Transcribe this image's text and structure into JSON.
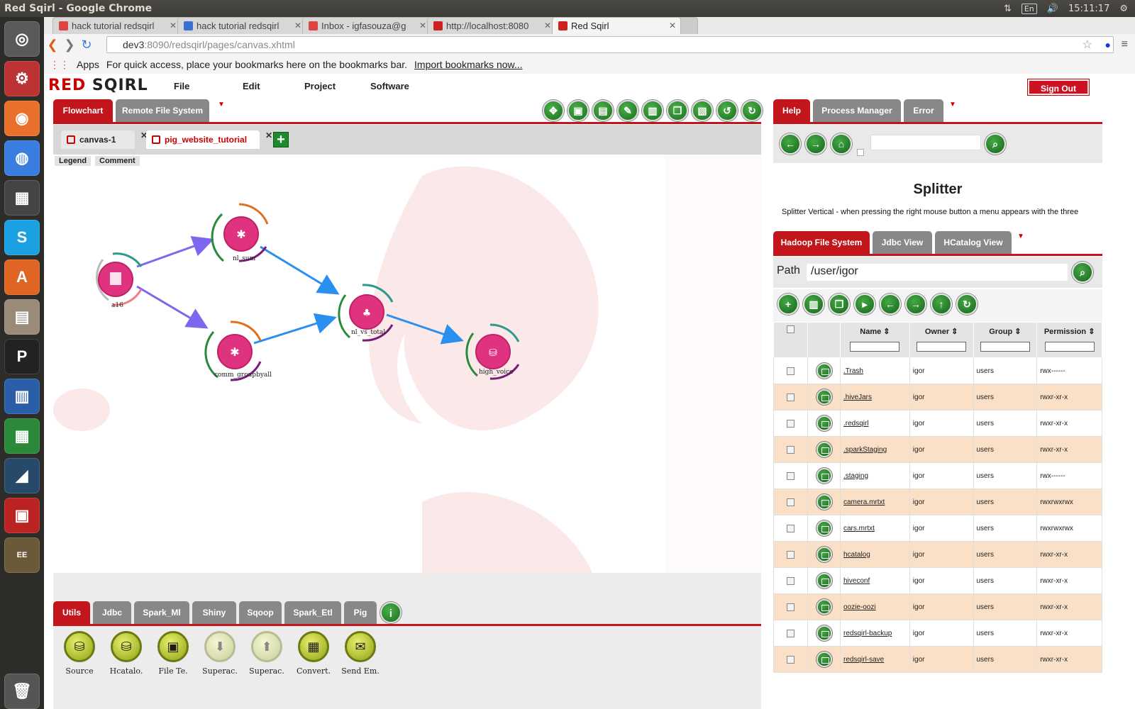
{
  "os": {
    "window_title": "Red Sqirl - Google Chrome",
    "keyboard": "En",
    "clock": "15:11:17"
  },
  "browser": {
    "tabs": [
      {
        "title": "hack tutorial redsqirl",
        "icon": "gmail-icon"
      },
      {
        "title": "hack tutorial redsqirl",
        "icon": "docs-icon"
      },
      {
        "title": "Inbox - igfasouza@g",
        "icon": "gmail-icon"
      },
      {
        "title": "http://localhost:8080",
        "icon": "redsqirl-icon"
      },
      {
        "title": "Red Sqirl",
        "icon": "redsqirl-icon"
      }
    ],
    "url_host": "dev3",
    "url_rest": ":8090/redsqirl/pages/canvas.xhtml",
    "bookmarks_apps": "Apps",
    "bookmarks_text": "For quick access, place your bookmarks here on the bookmarks bar.",
    "bookmarks_link": "Import bookmarks now..."
  },
  "app": {
    "logo_red": "RED",
    "logo_rest": " SQIRL",
    "menu": [
      "File",
      "Edit",
      "Project",
      "Software"
    ],
    "sign_out": "Sign Out"
  },
  "left": {
    "tabs": [
      "Flowchart",
      "Remote File System"
    ],
    "canvas_tabs": [
      "canvas-1",
      "pig_website_tutorial"
    ],
    "small_tabs": [
      "Legend",
      "Comment"
    ],
    "nodes": [
      {
        "label": "a16"
      },
      {
        "label": "nl_sum"
      },
      {
        "label": "comm_groupbyall"
      },
      {
        "label": "nl_vs_total"
      },
      {
        "label": "high_voice"
      }
    ],
    "palette_tabs": [
      "Utils",
      "Jdbc",
      "Spark_Ml",
      "Shiny",
      "Sqoop",
      "Spark_Etl",
      "Pig"
    ],
    "palette_items": [
      "Source",
      "Hcatalo.",
      "File Te.",
      "Superac.",
      "Superac.",
      "Convert.",
      "Send Em."
    ]
  },
  "right": {
    "tabs": [
      "Help",
      "Process Manager",
      "Error"
    ],
    "help_title": "Splitter",
    "help_text": "Splitter Vertical - when pressing the right mouse button a menu appears with the three options for Right, Middle, and Left. Clicking on the splitter option changes the position",
    "fs_tabs": [
      "Hadoop File System",
      "Jdbc View",
      "HCatalog View"
    ],
    "path_label": "Path",
    "path_value": "/user/igor",
    "columns": [
      "Name",
      "Owner",
      "Group",
      "Permission"
    ],
    "files": [
      {
        "name": ".Trash",
        "owner": "igor",
        "group": "users",
        "perm": "rwx------"
      },
      {
        "name": ".hiveJars",
        "owner": "igor",
        "group": "users",
        "perm": "rwxr-xr-x"
      },
      {
        "name": ".redsqirl",
        "owner": "igor",
        "group": "users",
        "perm": "rwxr-xr-x"
      },
      {
        "name": ".sparkStaging",
        "owner": "igor",
        "group": "users",
        "perm": "rwxr-xr-x"
      },
      {
        "name": ".staging",
        "owner": "igor",
        "group": "users",
        "perm": "rwx------"
      },
      {
        "name": "camera.mrtxt",
        "owner": "igor",
        "group": "users",
        "perm": "rwxrwxrwx"
      },
      {
        "name": "cars.mrtxt",
        "owner": "igor",
        "group": "users",
        "perm": "rwxrwxrwx"
      },
      {
        "name": "hcatalog",
        "owner": "igor",
        "group": "users",
        "perm": "rwxr-xr-x"
      },
      {
        "name": "hiveconf",
        "owner": "igor",
        "group": "users",
        "perm": "rwxr-xr-x"
      },
      {
        "name": "oozie-oozi",
        "owner": "igor",
        "group": "users",
        "perm": "rwxr-xr-x"
      },
      {
        "name": "redsqirl-backup",
        "owner": "igor",
        "group": "users",
        "perm": "rwxr-xr-x"
      },
      {
        "name": "redsqirl-save",
        "owner": "igor",
        "group": "users",
        "perm": "rwxr-xr-x"
      }
    ]
  },
  "colors": {
    "accent": "#c3161c",
    "button_green": "#1a6e1a",
    "node_pink": "#e0337f",
    "row_stripe": "#fae0c7"
  }
}
